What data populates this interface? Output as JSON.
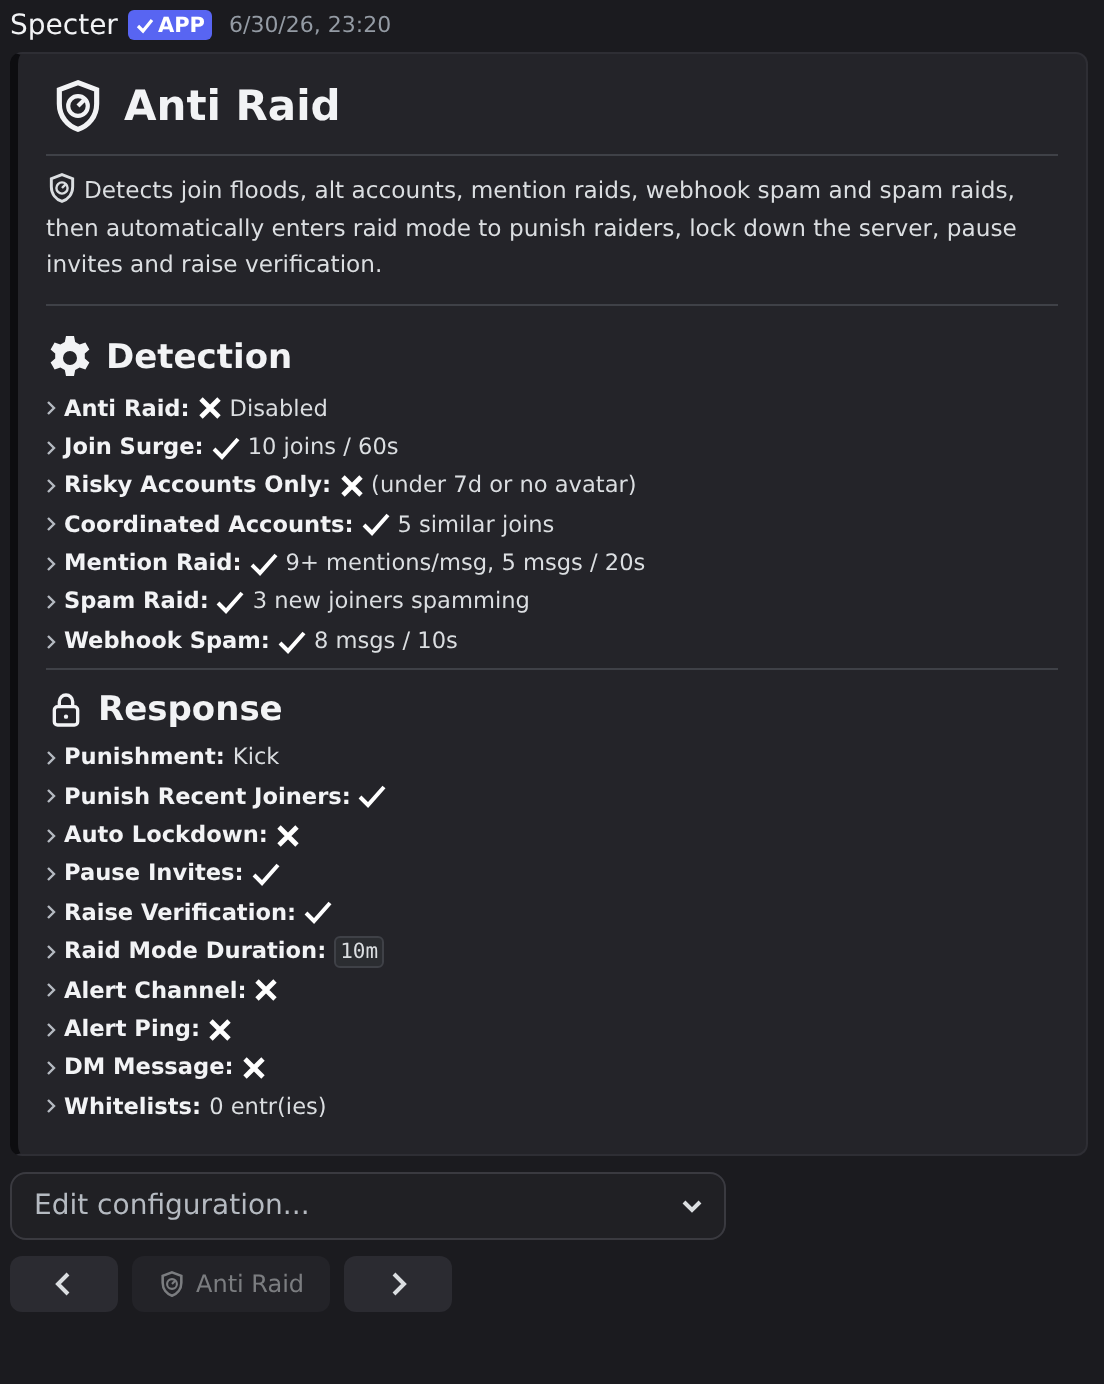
{
  "message": {
    "author": "Specter",
    "badge": "APP",
    "verified": true,
    "timestamp": "6/30/26, 23:20"
  },
  "embed": {
    "title": "Anti Raid",
    "description": "Detects join floods, alt accounts, mention raids, webhook spam and spam raids, then automatically enters raid mode to punish raiders, lock down the server, pause invites and raise verification.",
    "sections": [
      {
        "title": "Detection",
        "items": [
          {
            "label": "Anti Raid:",
            "enabled": false,
            "value": "Disabled"
          },
          {
            "label": "Join Surge:",
            "enabled": true,
            "value": "10 joins / 60s"
          },
          {
            "label": "Risky Accounts Only:",
            "enabled": false,
            "value": "(under 7d or no avatar)"
          },
          {
            "label": "Coordinated Accounts:",
            "enabled": true,
            "value": "5 similar joins"
          },
          {
            "label": "Mention Raid:",
            "enabled": true,
            "value": "9+ mentions/msg, 5 msgs / 20s"
          },
          {
            "label": "Spam Raid:",
            "enabled": true,
            "value": "3 new joiners spamming"
          },
          {
            "label": "Webhook Spam:",
            "enabled": true,
            "value": "8 msgs / 10s"
          }
        ]
      },
      {
        "title": "Response",
        "items": [
          {
            "label": "Punishment:",
            "value": "Kick"
          },
          {
            "label": "Punish Recent Joiners:",
            "enabled": true
          },
          {
            "label": "Auto Lockdown:",
            "enabled": false
          },
          {
            "label": "Pause Invites:",
            "enabled": true
          },
          {
            "label": "Raise Verification:",
            "enabled": true
          },
          {
            "label": "Raid Mode Duration:",
            "code": "10m"
          },
          {
            "label": "Alert Channel:",
            "enabled": false
          },
          {
            "label": "Alert Ping:",
            "enabled": false
          },
          {
            "label": "DM Message:",
            "enabled": false
          },
          {
            "label": "Whitelists:",
            "value": "0 entr(ies)"
          }
        ]
      }
    ]
  },
  "select": {
    "placeholder": "Edit configuration..."
  },
  "buttons": [
    {
      "kind": "prev",
      "disabled": false
    },
    {
      "kind": "label",
      "label": "Anti Raid",
      "disabled": true
    },
    {
      "kind": "next",
      "disabled": false
    }
  ]
}
